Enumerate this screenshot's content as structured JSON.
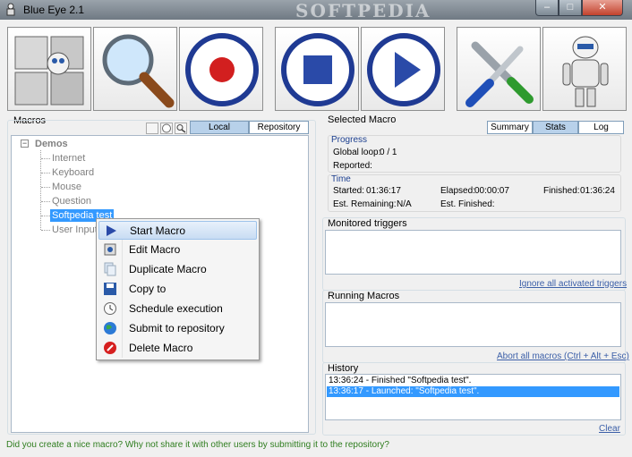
{
  "window": {
    "title": "Blue Eye 2.1",
    "watermark": "SOFTPEDIA",
    "min_glyph": "–",
    "max_glyph": "□",
    "close_glyph": "✕"
  },
  "toolbar": {
    "buttons": [
      {
        "name": "macro-puzzle-icon"
      },
      {
        "name": "magnifier-icon"
      },
      {
        "name": "record-icon"
      },
      {
        "name": "stop-icon"
      },
      {
        "name": "play-icon"
      },
      {
        "name": "tools-icon"
      },
      {
        "name": "robot-icon"
      }
    ]
  },
  "macros": {
    "title": "Macros",
    "tabs": [
      "Local",
      "Repository"
    ],
    "active_tab": "Local",
    "root": "Demos",
    "collapse_glyph": "−",
    "items": [
      "Internet",
      "Keyboard",
      "Mouse",
      "Question",
      "Softpedia test",
      "User Input"
    ],
    "selected": "Softpedia test"
  },
  "context_menu": {
    "items": [
      {
        "label": "Start Macro",
        "icon": "play-icon"
      },
      {
        "label": "Edit Macro",
        "icon": "edit-icon"
      },
      {
        "label": "Duplicate Macro",
        "icon": "duplicate-icon"
      },
      {
        "label": "Copy to",
        "icon": "save-icon"
      },
      {
        "label": "Schedule execution",
        "icon": "clock-icon"
      },
      {
        "label": "Submit to repository",
        "icon": "globe-icon"
      },
      {
        "label": "Delete Macro",
        "icon": "delete-icon"
      }
    ],
    "highlighted": "Start Macro"
  },
  "selected_macro": {
    "title": "Selected Macro",
    "tabs": [
      "Summary",
      "Stats",
      "Log"
    ],
    "active_tab": "Stats",
    "progress": {
      "heading": "Progress",
      "global_loop_label": "Global loop:",
      "global_loop_value": "0 / 1",
      "reported_label": "Reported:",
      "reported_value": ""
    },
    "time": {
      "heading": "Time",
      "started_label": "Started:",
      "started_value": "01:36:17",
      "elapsed_label": "Elapsed:",
      "elapsed_value": "00:00:07",
      "finished_label": "Finished:",
      "finished_value": "01:36:24",
      "remaining_label": "Est. Remaining:",
      "remaining_value": "N/A",
      "est_finished_label": "Est. Finished:",
      "est_finished_value": ""
    }
  },
  "monitored_triggers": {
    "title": "Monitored triggers",
    "link": "Ignore all activated triggers"
  },
  "running_macros": {
    "title": "Running Macros",
    "link": "Abort all macros (Ctrl + Alt + Esc)"
  },
  "history": {
    "title": "History",
    "entries": [
      "13:36:24 - Finished \"Softpedia test\".",
      "13:36:17 - Launched: \"Softpedia test\"."
    ],
    "selected_index": 1,
    "clear": "Clear"
  },
  "status": "Did you create a nice macro? Why not share it with other users by submitting it to the repository?"
}
